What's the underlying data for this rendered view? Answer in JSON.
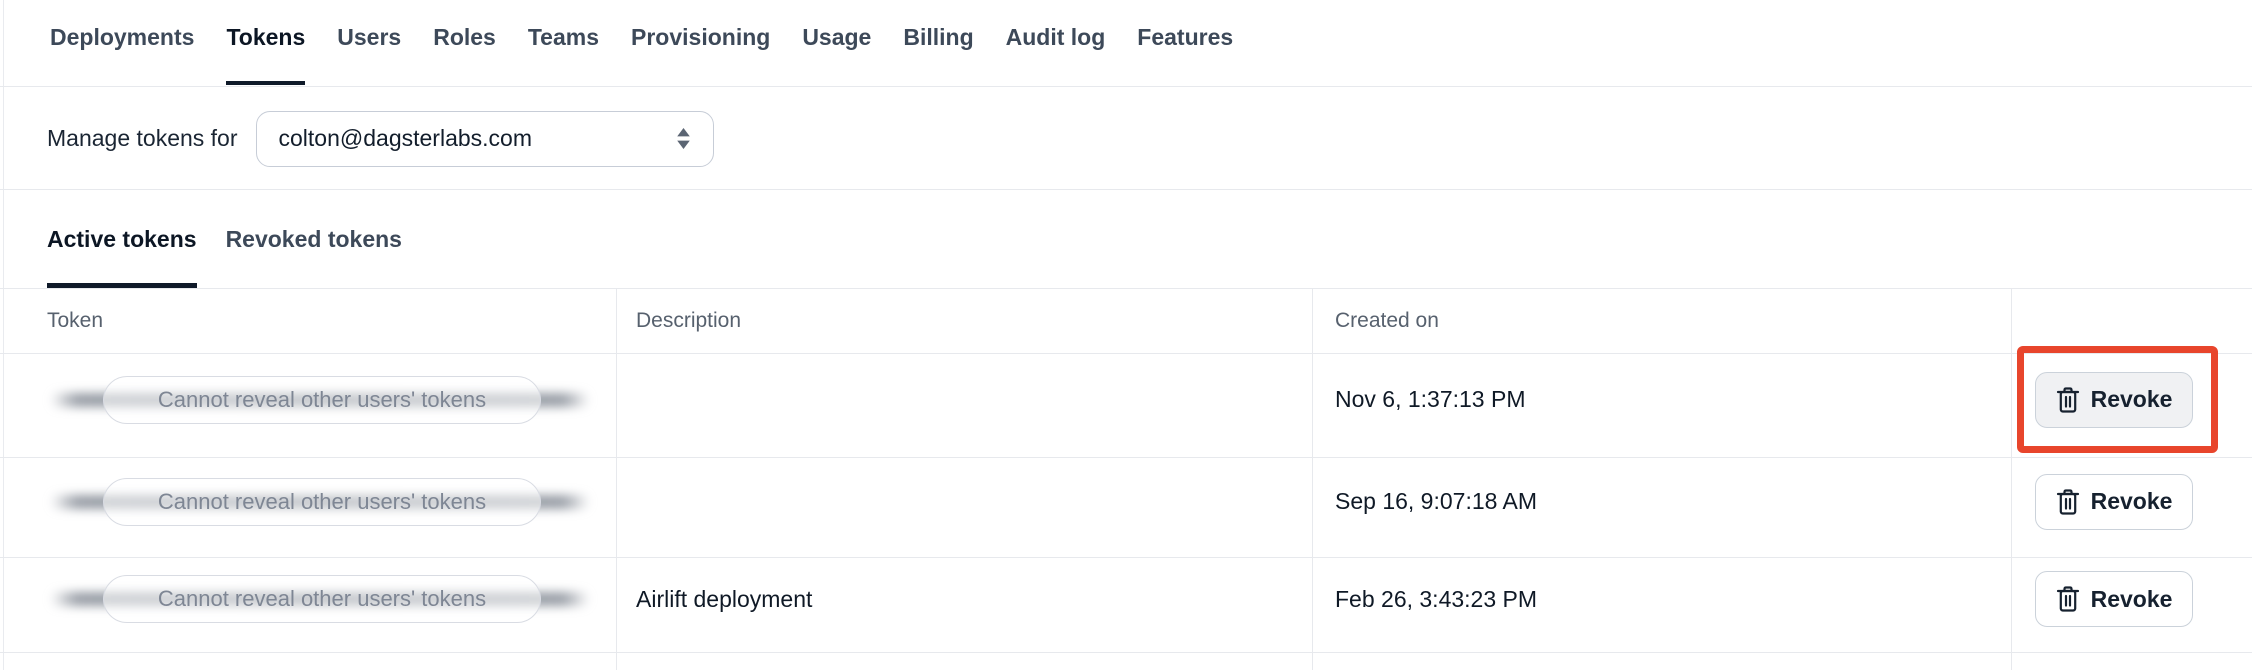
{
  "nav": {
    "tabs": [
      {
        "label": "Deployments",
        "active": false
      },
      {
        "label": "Tokens",
        "active": true
      },
      {
        "label": "Users",
        "active": false
      },
      {
        "label": "Roles",
        "active": false
      },
      {
        "label": "Teams",
        "active": false
      },
      {
        "label": "Provisioning",
        "active": false
      },
      {
        "label": "Usage",
        "active": false
      },
      {
        "label": "Billing",
        "active": false
      },
      {
        "label": "Audit log",
        "active": false
      },
      {
        "label": "Features",
        "active": false
      }
    ]
  },
  "manage": {
    "label": "Manage tokens for",
    "selected_user": "colton@dagsterlabs.com",
    "select_icon": "sort-arrows-icon"
  },
  "token_tabs": [
    {
      "label": "Active tokens",
      "active": true
    },
    {
      "label": "Revoked tokens",
      "active": false
    }
  ],
  "table": {
    "columns": {
      "token": "Token",
      "description": "Description",
      "created_on": "Created on"
    },
    "redacted_label": "Cannot reveal other users' tokens",
    "revoke_label": "Revoke",
    "revoke_icon": "trash-icon",
    "rows": [
      {
        "token_redacted": true,
        "description": "",
        "created_on": "Nov 6, 1:37:13 PM",
        "highlighted": true
      },
      {
        "token_redacted": true,
        "description": "",
        "created_on": "Sep 16, 9:07:18 AM",
        "highlighted": false
      },
      {
        "token_redacted": true,
        "description": "Airlift deployment",
        "created_on": "Feb 26, 3:43:23 PM",
        "highlighted": false
      }
    ]
  },
  "annotation": {
    "type": "highlight-box",
    "color": "#E8452C",
    "target": "first-row-revoke-button"
  }
}
